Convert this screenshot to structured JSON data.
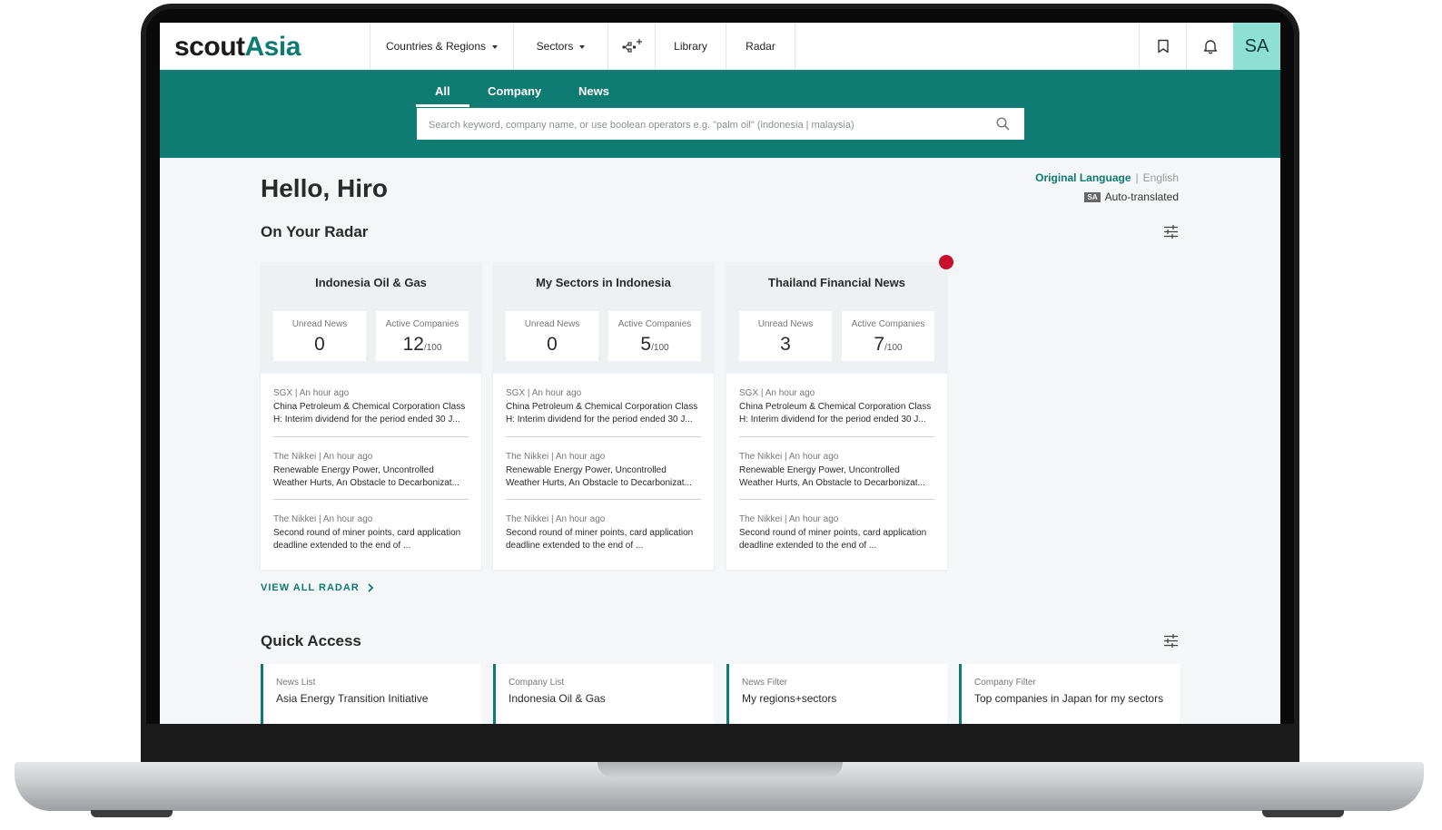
{
  "header": {
    "logo_part1": "scout",
    "logo_part2": "Asia",
    "nav": [
      "Countries & Regions",
      "Sectors",
      "Library",
      "Radar"
    ],
    "avatar_initials": "SA"
  },
  "search": {
    "tabs": [
      "All",
      "Company",
      "News"
    ],
    "active_tab": "All",
    "placeholder": "Search keyword, company name, or use boolean operators e.g. \"palm oil\" (indonesia | malaysia)"
  },
  "greeting": "Hello, Hiro",
  "language": {
    "original": "Original Language",
    "separator": "|",
    "english": "English",
    "badge": "SA",
    "auto": "Auto-translated"
  },
  "radar": {
    "title": "On Your Radar",
    "view_all": "VIEW ALL RADAR",
    "unread_label": "Unread News",
    "active_label": "Active Companies",
    "cards": [
      {
        "title": "Indonesia Oil & Gas",
        "unread": "0",
        "active": "12",
        "active_total": "/100",
        "news": [
          {
            "meta": "SGX  |  An hour ago",
            "text": "China Petroleum & Chemical Corporation Class H: Interim dividend for the period ended 30 J..."
          },
          {
            "meta": "The Nikkei  |  An hour ago",
            "text": "Renewable Energy Power, Uncontrolled Weather Hurts, An Obstacle to Decarbonizat..."
          },
          {
            "meta": "The Nikkei  |  An hour ago",
            "text": "Second round of miner points, card application deadline extended to the end of ..."
          }
        ]
      },
      {
        "title": "My Sectors in Indonesia",
        "unread": "0",
        "active": "5",
        "active_total": "/100",
        "news": [
          {
            "meta": "SGX  |  An hour ago",
            "text": "China Petroleum & Chemical Corporation Class H: Interim dividend for the period ended 30 J..."
          },
          {
            "meta": "The Nikkei  |  An hour ago",
            "text": "Renewable Energy Power, Uncontrolled Weather Hurts, An Obstacle to Decarbonizat..."
          },
          {
            "meta": "The Nikkei  |  An hour ago",
            "text": "Second round of miner points, card application deadline extended to the end of ..."
          }
        ]
      },
      {
        "title": "Thailand Financial News",
        "unread": "3",
        "active": "7",
        "active_total": "/100",
        "news": [
          {
            "meta": "SGX  |  An hour ago",
            "text": "China Petroleum & Chemical Corporation Class H: Interim dividend for the period ended 30 J..."
          },
          {
            "meta": "The Nikkei  |  An hour ago",
            "text": "Renewable Energy Power, Uncontrolled Weather Hurts, An Obstacle to Decarbonizat..."
          },
          {
            "meta": "The Nikkei  |  An hour ago",
            "text": "Second round of miner points, card application deadline extended to the end of ..."
          }
        ]
      }
    ]
  },
  "quick_access": {
    "title": "Quick Access",
    "items": [
      {
        "type": "News List",
        "name": "Asia Energy Transition Initiative"
      },
      {
        "type": "Company List",
        "name": "Indonesia Oil & Gas"
      },
      {
        "type": "News Filter",
        "name": "My regions+sectors"
      },
      {
        "type": "Company Filter",
        "name": "Top companies in Japan for my sectors"
      }
    ]
  },
  "colors": {
    "brand": "#0f7c74",
    "avatar_bg": "#8ee0d4",
    "notification_dot": "#c8102e"
  }
}
